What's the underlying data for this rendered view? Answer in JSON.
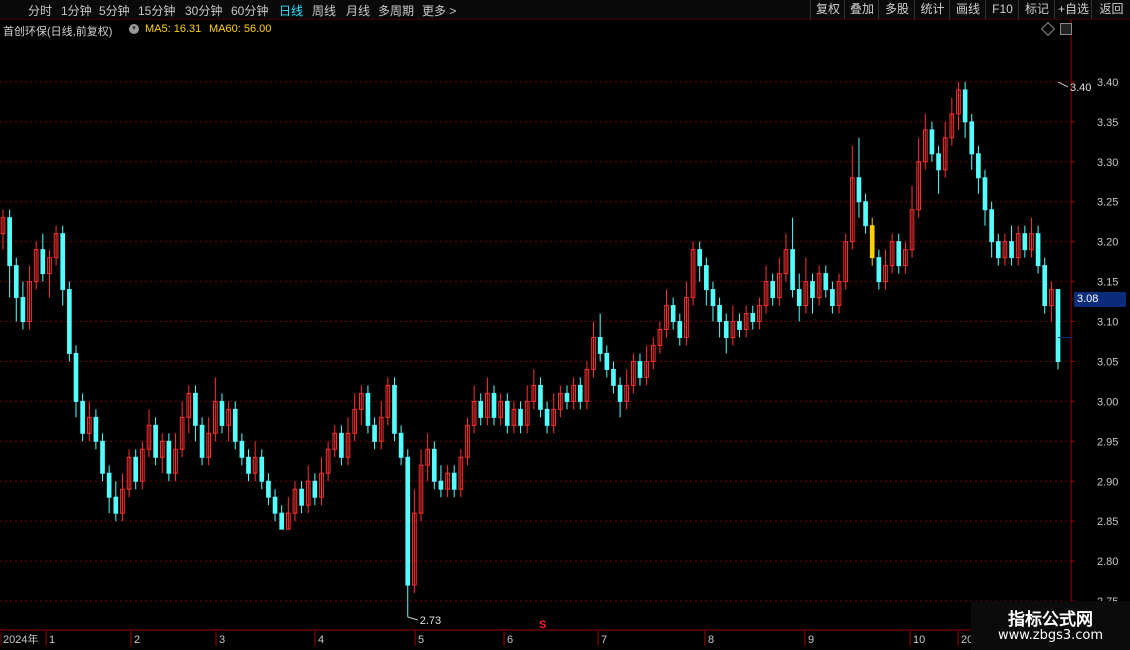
{
  "toolbar": {
    "periods": [
      "分时",
      "1分钟",
      "5分钟",
      "15分钟",
      "30分钟",
      "60分钟",
      "日线",
      "周线",
      "月线",
      "多周期",
      "更多 >"
    ],
    "active_period": "日线",
    "right_buttons": [
      "复权",
      "叠加",
      "多股",
      "统计",
      "画线",
      "F10",
      "标记",
      "+自选",
      "返回"
    ]
  },
  "info": {
    "stock_name": "首创环保(日线,前复权)",
    "ma5": "MA5: 16.31",
    "ma60": "MA60: 56.00"
  },
  "watermark": {
    "title": "指标公式网",
    "url": "www.zbgs3.com"
  },
  "chart_data": {
    "type": "candlestick",
    "title": "",
    "y_ticks": [
      "3.40",
      "3.35",
      "3.30",
      "3.25",
      "3.20",
      "3.15",
      "3.10",
      "3.05",
      "3.00",
      "2.95",
      "2.90",
      "2.85",
      "2.80",
      "2.75"
    ],
    "ylim": [
      2.715,
      3.455
    ],
    "x_labels": [
      "2024年",
      "1",
      "2",
      "3",
      "4",
      "5",
      "6",
      "7",
      "8",
      "9",
      "10",
      "20"
    ],
    "current_price": "3.08",
    "max_label": "3.40",
    "min_label": "2.73",
    "marker": "S",
    "colors": {
      "up": "#ff3030",
      "down": "#54ffff",
      "highlight": "#ffd000",
      "grid": "#7a0000",
      "axis": "#a00000"
    },
    "candles": [
      [
        3.21,
        3.23,
        3.24,
        3.19
      ],
      [
        3.23,
        3.17,
        3.24,
        3.13
      ],
      [
        3.17,
        3.13,
        3.18,
        3.1
      ],
      [
        3.13,
        3.1,
        3.15,
        3.09
      ],
      [
        3.1,
        3.15,
        3.17,
        3.09
      ],
      [
        3.15,
        3.19,
        3.2,
        3.14
      ],
      [
        3.19,
        3.16,
        3.21,
        3.15
      ],
      [
        3.16,
        3.18,
        3.19,
        3.13
      ],
      [
        3.18,
        3.21,
        3.22,
        3.17
      ],
      [
        3.21,
        3.14,
        3.22,
        3.12
      ],
      [
        3.14,
        3.06,
        3.15,
        3.05
      ],
      [
        3.06,
        3.0,
        3.07,
        2.98
      ],
      [
        3.0,
        2.96,
        3.01,
        2.95
      ],
      [
        2.96,
        2.98,
        3.0,
        2.95
      ],
      [
        2.98,
        2.95,
        2.99,
        2.94
      ],
      [
        2.95,
        2.91,
        2.96,
        2.9
      ],
      [
        2.91,
        2.88,
        2.92,
        2.86
      ],
      [
        2.88,
        2.86,
        2.9,
        2.85
      ],
      [
        2.86,
        2.89,
        2.91,
        2.85
      ],
      [
        2.89,
        2.93,
        2.94,
        2.88
      ],
      [
        2.93,
        2.9,
        2.94,
        2.89
      ],
      [
        2.9,
        2.94,
        2.95,
        2.89
      ],
      [
        2.94,
        2.97,
        2.99,
        2.93
      ],
      [
        2.97,
        2.93,
        2.98,
        2.92
      ],
      [
        2.93,
        2.95,
        2.96,
        2.91
      ],
      [
        2.95,
        2.91,
        2.96,
        2.9
      ],
      [
        2.91,
        2.94,
        2.96,
        2.9
      ],
      [
        2.94,
        2.98,
        3.0,
        2.93
      ],
      [
        2.98,
        3.01,
        3.02,
        2.96
      ],
      [
        3.01,
        2.97,
        3.02,
        2.95
      ],
      [
        2.97,
        2.93,
        2.98,
        2.92
      ],
      [
        2.93,
        2.96,
        2.98,
        2.92
      ],
      [
        2.96,
        3.0,
        3.03,
        2.95
      ],
      [
        3.0,
        2.97,
        3.01,
        2.96
      ],
      [
        2.97,
        2.99,
        3.0,
        2.95
      ],
      [
        2.99,
        2.95,
        3.0,
        2.94
      ],
      [
        2.95,
        2.93,
        2.96,
        2.92
      ],
      [
        2.93,
        2.91,
        2.94,
        2.9
      ],
      [
        2.91,
        2.93,
        2.95,
        2.9
      ],
      [
        2.93,
        2.9,
        2.94,
        2.89
      ],
      [
        2.9,
        2.88,
        2.91,
        2.87
      ],
      [
        2.88,
        2.86,
        2.89,
        2.85
      ],
      [
        2.86,
        2.84,
        2.87,
        2.84
      ],
      [
        2.84,
        2.86,
        2.88,
        2.84
      ],
      [
        2.86,
        2.89,
        2.9,
        2.85
      ],
      [
        2.89,
        2.87,
        2.9,
        2.86
      ],
      [
        2.87,
        2.9,
        2.92,
        2.86
      ],
      [
        2.9,
        2.88,
        2.91,
        2.87
      ],
      [
        2.88,
        2.91,
        2.93,
        2.87
      ],
      [
        2.91,
        2.94,
        2.95,
        2.9
      ],
      [
        2.94,
        2.96,
        2.97,
        2.93
      ],
      [
        2.96,
        2.93,
        2.97,
        2.92
      ],
      [
        2.93,
        2.96,
        2.98,
        2.92
      ],
      [
        2.96,
        2.99,
        3.01,
        2.95
      ],
      [
        2.99,
        3.01,
        3.02,
        2.97
      ],
      [
        3.01,
        2.97,
        3.02,
        2.96
      ],
      [
        2.97,
        2.95,
        2.98,
        2.94
      ],
      [
        2.95,
        2.98,
        3.0,
        2.94
      ],
      [
        2.98,
        3.02,
        3.03,
        2.97
      ],
      [
        3.02,
        2.96,
        3.03,
        2.95
      ],
      [
        2.96,
        2.93,
        2.97,
        2.92
      ],
      [
        2.93,
        2.77,
        2.94,
        2.73
      ],
      [
        2.77,
        2.86,
        2.89,
        2.76
      ],
      [
        2.86,
        2.92,
        2.94,
        2.85
      ],
      [
        2.92,
        2.94,
        2.96,
        2.9
      ],
      [
        2.94,
        2.9,
        2.95,
        2.89
      ],
      [
        2.9,
        2.89,
        2.92,
        2.88
      ],
      [
        2.89,
        2.91,
        2.92,
        2.88
      ],
      [
        2.91,
        2.89,
        2.92,
        2.88
      ],
      [
        2.89,
        2.93,
        2.94,
        2.88
      ],
      [
        2.93,
        2.97,
        2.98,
        2.92
      ],
      [
        2.97,
        3.0,
        3.02,
        2.96
      ],
      [
        3.0,
        2.98,
        3.01,
        2.97
      ],
      [
        2.98,
        3.01,
        3.03,
        2.97
      ],
      [
        3.01,
        2.98,
        3.02,
        2.97
      ],
      [
        2.98,
        3.0,
        3.01,
        2.97
      ],
      [
        3.0,
        2.97,
        3.01,
        2.96
      ],
      [
        2.97,
        2.99,
        3.0,
        2.96
      ],
      [
        2.99,
        2.97,
        3.0,
        2.96
      ],
      [
        2.97,
        3.0,
        3.02,
        2.96
      ],
      [
        3.0,
        3.02,
        3.04,
        2.99
      ],
      [
        3.02,
        2.99,
        3.03,
        2.98
      ],
      [
        2.99,
        2.97,
        3.0,
        2.96
      ],
      [
        2.97,
        2.99,
        3.01,
        2.96
      ],
      [
        2.99,
        3.01,
        3.02,
        2.98
      ],
      [
        3.01,
        3.0,
        3.02,
        2.99
      ],
      [
        3.0,
        3.02,
        3.03,
        2.99
      ],
      [
        3.02,
        3.0,
        3.03,
        2.99
      ],
      [
        3.0,
        3.04,
        3.05,
        2.99
      ],
      [
        3.04,
        3.08,
        3.1,
        3.03
      ],
      [
        3.08,
        3.06,
        3.11,
        3.05
      ],
      [
        3.06,
        3.04,
        3.07,
        3.03
      ],
      [
        3.04,
        3.02,
        3.05,
        3.01
      ],
      [
        3.02,
        3.0,
        3.03,
        2.98
      ],
      [
        3.0,
        3.02,
        3.04,
        2.99
      ],
      [
        3.02,
        3.05,
        3.06,
        3.01
      ],
      [
        3.05,
        3.03,
        3.06,
        3.02
      ],
      [
        3.03,
        3.05,
        3.07,
        3.02
      ],
      [
        3.05,
        3.07,
        3.08,
        3.04
      ],
      [
        3.07,
        3.09,
        3.1,
        3.06
      ],
      [
        3.09,
        3.12,
        3.14,
        3.08
      ],
      [
        3.12,
        3.1,
        3.13,
        3.09
      ],
      [
        3.1,
        3.08,
        3.11,
        3.07
      ],
      [
        3.08,
        3.13,
        3.15,
        3.07
      ],
      [
        3.13,
        3.19,
        3.2,
        3.12
      ],
      [
        3.19,
        3.17,
        3.2,
        3.15
      ],
      [
        3.17,
        3.14,
        3.18,
        3.12
      ],
      [
        3.14,
        3.12,
        3.15,
        3.1
      ],
      [
        3.12,
        3.1,
        3.13,
        3.08
      ],
      [
        3.1,
        3.08,
        3.11,
        3.06
      ],
      [
        3.08,
        3.1,
        3.12,
        3.07
      ],
      [
        3.1,
        3.09,
        3.11,
        3.08
      ],
      [
        3.09,
        3.11,
        3.12,
        3.08
      ],
      [
        3.11,
        3.1,
        3.12,
        3.09
      ],
      [
        3.1,
        3.12,
        3.13,
        3.09
      ],
      [
        3.12,
        3.15,
        3.17,
        3.11
      ],
      [
        3.15,
        3.13,
        3.16,
        3.12
      ],
      [
        3.13,
        3.16,
        3.18,
        3.12
      ],
      [
        3.16,
        3.19,
        3.21,
        3.15
      ],
      [
        3.19,
        3.14,
        3.23,
        3.13
      ],
      [
        3.14,
        3.12,
        3.16,
        3.1
      ],
      [
        3.12,
        3.15,
        3.18,
        3.11
      ],
      [
        3.15,
        3.13,
        3.16,
        3.11
      ],
      [
        3.13,
        3.16,
        3.17,
        3.12
      ],
      [
        3.16,
        3.14,
        3.17,
        3.13
      ],
      [
        3.14,
        3.12,
        3.15,
        3.11
      ],
      [
        3.12,
        3.15,
        3.16,
        3.11
      ],
      [
        3.15,
        3.2,
        3.21,
        3.14
      ],
      [
        3.2,
        3.28,
        3.32,
        3.19
      ],
      [
        3.28,
        3.25,
        3.33,
        3.23
      ],
      [
        3.25,
        3.22,
        3.26,
        3.21
      ],
      [
        3.22,
        3.18,
        3.23,
        3.17
      ],
      [
        3.18,
        3.15,
        3.19,
        3.14
      ],
      [
        3.15,
        3.17,
        3.19,
        3.14
      ],
      [
        3.17,
        3.2,
        3.21,
        3.16
      ],
      [
        3.2,
        3.17,
        3.21,
        3.16
      ],
      [
        3.17,
        3.19,
        3.2,
        3.16
      ],
      [
        3.19,
        3.24,
        3.27,
        3.18
      ],
      [
        3.24,
        3.3,
        3.33,
        3.23
      ],
      [
        3.3,
        3.34,
        3.36,
        3.29
      ],
      [
        3.34,
        3.31,
        3.35,
        3.3
      ],
      [
        3.31,
        3.29,
        3.32,
        3.26
      ],
      [
        3.29,
        3.33,
        3.35,
        3.28
      ],
      [
        3.33,
        3.36,
        3.38,
        3.32
      ],
      [
        3.36,
        3.39,
        3.4,
        3.34
      ],
      [
        3.39,
        3.35,
        3.4,
        3.33
      ],
      [
        3.35,
        3.31,
        3.36,
        3.29
      ],
      [
        3.31,
        3.28,
        3.32,
        3.26
      ],
      [
        3.28,
        3.24,
        3.29,
        3.22
      ],
      [
        3.24,
        3.2,
        3.25,
        3.18
      ],
      [
        3.2,
        3.18,
        3.21,
        3.17
      ],
      [
        3.18,
        3.2,
        3.21,
        3.17
      ],
      [
        3.2,
        3.18,
        3.22,
        3.17
      ],
      [
        3.18,
        3.21,
        3.22,
        3.17
      ],
      [
        3.21,
        3.19,
        3.22,
        3.18
      ],
      [
        3.19,
        3.21,
        3.23,
        3.18
      ],
      [
        3.21,
        3.17,
        3.22,
        3.16
      ],
      [
        3.17,
        3.12,
        3.18,
        3.11
      ],
      [
        3.12,
        3.14,
        3.15,
        3.1
      ],
      [
        3.14,
        3.05,
        3.14,
        3.04
      ]
    ]
  }
}
